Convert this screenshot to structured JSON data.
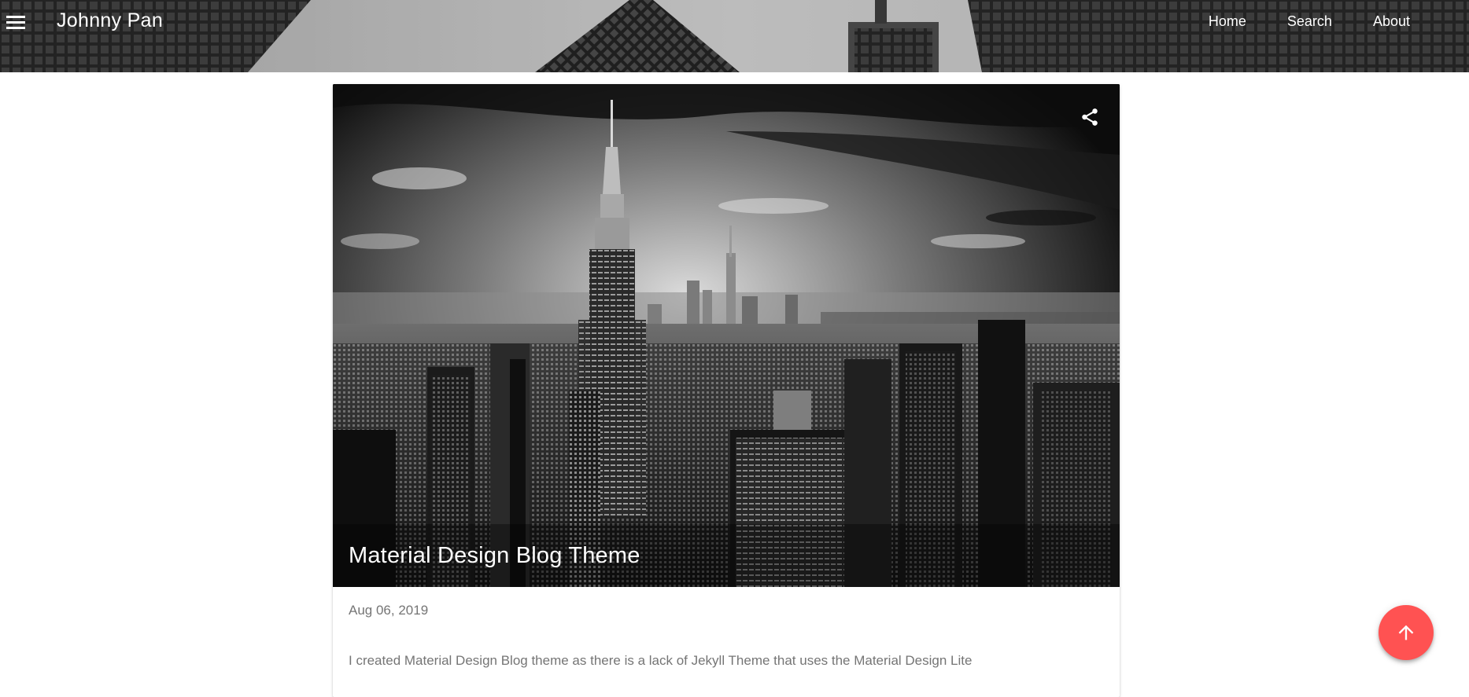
{
  "header": {
    "site_title": "Johnny Pan",
    "menu_icon": "menu-icon",
    "nav": [
      {
        "label": "Home"
      },
      {
        "label": "Search"
      },
      {
        "label": "About"
      }
    ]
  },
  "post": {
    "title": "Material Design Blog Theme",
    "date": "Aug 06, 2019",
    "excerpt": "I created Material Design Blog theme as there is a lack of Jekyll Theme that uses the Material Design Lite",
    "share_icon": "share-icon"
  },
  "fab": {
    "icon": "arrow-up-icon",
    "color": "#ff5252"
  }
}
